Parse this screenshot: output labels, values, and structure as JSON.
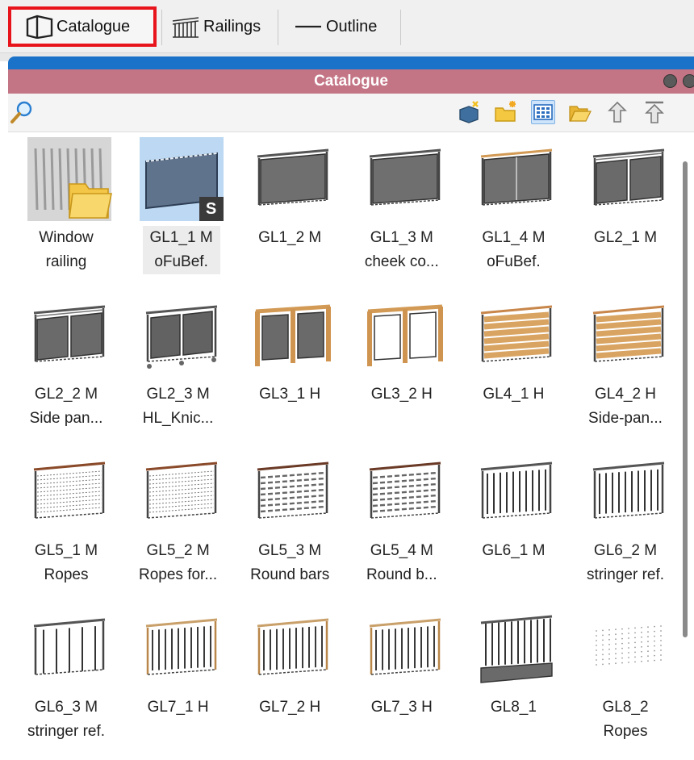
{
  "toolbar": {
    "catalogue_label": "Catalogue",
    "railings_label": "Railings",
    "outline_label": "Outline"
  },
  "panel": {
    "title": "Catalogue",
    "title_color": "#c47585",
    "accent_blue": "#1a72c9",
    "tools": [
      "search-icon",
      "import-icon",
      "new-folder-icon",
      "view-grid-icon",
      "open-folder-icon",
      "up-icon",
      "top-icon"
    ]
  },
  "items": [
    {
      "line1": "Window",
      "line2": "railing",
      "kind": "folder"
    },
    {
      "line1": "GL1_1 M",
      "line2": "oFuBef.",
      "kind": "glass-selected",
      "badge": "S"
    },
    {
      "line1": "GL1_2 M",
      "line2": "",
      "kind": "glass"
    },
    {
      "line1": "GL1_3 M",
      "line2": "cheek co...",
      "kind": "glass"
    },
    {
      "line1": "GL1_4 M",
      "line2": "oFuBef.",
      "kind": "glass-wood-rail"
    },
    {
      "line1": "GL2_1 M",
      "line2": "",
      "kind": "glass-split"
    },
    {
      "line1": "GL2_2 M",
      "line2": "Side pan...",
      "kind": "glass-split"
    },
    {
      "line1": "GL2_3 M",
      "line2": "HL_Knic...",
      "kind": "glass-split-posts"
    },
    {
      "line1": "GL3_1 H",
      "line2": "",
      "kind": "wood-frame-glass"
    },
    {
      "line1": "GL3_2 H",
      "line2": "",
      "kind": "wood-frame-white"
    },
    {
      "line1": "GL4_1 H",
      "line2": "",
      "kind": "wood-slats"
    },
    {
      "line1": "GL4_2 H",
      "line2": "Side-pan...",
      "kind": "wood-slats"
    },
    {
      "line1": "GL5_1 M",
      "line2": "Ropes",
      "kind": "ropes"
    },
    {
      "line1": "GL5_2 M",
      "line2": "Ropes for...",
      "kind": "ropes"
    },
    {
      "line1": "GL5_3 M",
      "line2": "Round bars",
      "kind": "bars"
    },
    {
      "line1": "GL5_4 M",
      "line2": "Round b...",
      "kind": "bars"
    },
    {
      "line1": "GL6_1 M",
      "line2": "",
      "kind": "balusters"
    },
    {
      "line1": "GL6_2 M",
      "line2": "stringer ref.",
      "kind": "balusters"
    },
    {
      "line1": "GL6_3 M",
      "line2": "stringer ref.",
      "kind": "balusters-open"
    },
    {
      "line1": "GL7_1 H",
      "line2": "",
      "kind": "balusters-wood"
    },
    {
      "line1": "GL7_2 H",
      "line2": "",
      "kind": "balusters-wood"
    },
    {
      "line1": "GL7_3 H",
      "line2": "",
      "kind": "balusters-wood"
    },
    {
      "line1": "GL8_1",
      "line2": "",
      "kind": "balusters-base"
    },
    {
      "line1": "GL8_2",
      "line2": "Ropes",
      "kind": "dots"
    }
  ]
}
